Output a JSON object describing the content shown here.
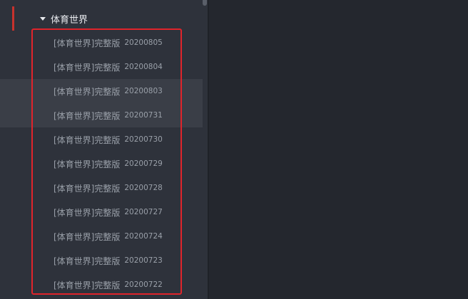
{
  "section": {
    "title": "体育世界"
  },
  "episodes": [
    {
      "title": "[体育世界]完整版",
      "date": "20200805",
      "highlight": false
    },
    {
      "title": "[体育世界]完整版",
      "date": "20200804",
      "highlight": false
    },
    {
      "title": "[体育世界]完整版",
      "date": "20200803",
      "highlight": true
    },
    {
      "title": "[体育世界]完整版",
      "date": "20200731",
      "highlight": true
    },
    {
      "title": "[体育世界]完整版",
      "date": "20200730",
      "highlight": false
    },
    {
      "title": "[体育世界]完整版",
      "date": "20200729",
      "highlight": false
    },
    {
      "title": "[体育世界]完整版",
      "date": "20200728",
      "highlight": false
    },
    {
      "title": "[体育世界]完整版",
      "date": "20200727",
      "highlight": false
    },
    {
      "title": "[体育世界]完整版",
      "date": "20200724",
      "highlight": false
    },
    {
      "title": "[体育世界]完整版",
      "date": "20200723",
      "highlight": false
    },
    {
      "title": "[体育世界]完整版",
      "date": "20200722",
      "highlight": false
    }
  ],
  "colors": {
    "sidebar_bg": "#2e323b",
    "main_bg": "#24272e",
    "accent": "#c8322d",
    "annotation": "#e0242b",
    "text_primary": "#e9ebef",
    "text_secondary": "#9aa0a9"
  },
  "icons": {
    "section_toggle": "caret-down-icon"
  }
}
